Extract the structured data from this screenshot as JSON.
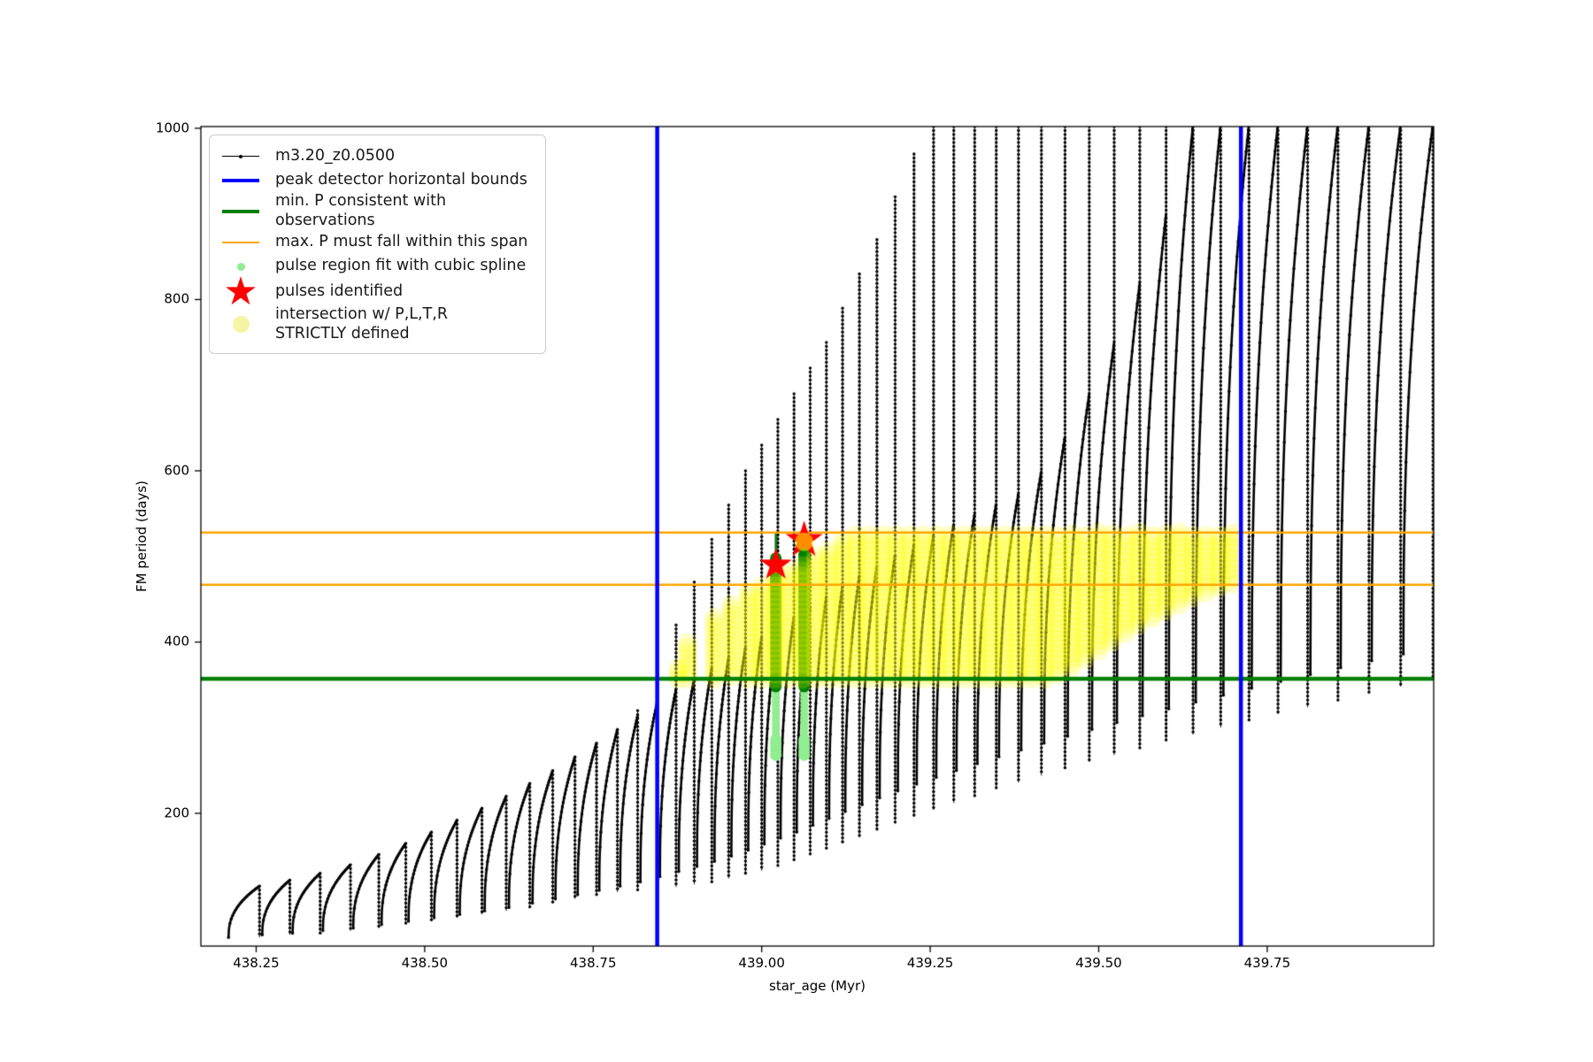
{
  "figure": {
    "background": "#ffffff",
    "xlabel": "star_age (Myr)",
    "ylabel": "FM period (days)"
  },
  "legend": {
    "items": [
      {
        "glyph": "black-line-dot-marker",
        "color": "#000000",
        "label": "m3.20_z0.0500"
      },
      {
        "glyph": "thick-blue-line",
        "color": "#0000ff",
        "label": "peak detector horizontal bounds"
      },
      {
        "glyph": "thick-green-line",
        "color": "#008000",
        "label": "min. P consistent with observations"
      },
      {
        "glyph": "thin-orange-line",
        "color": "#ffa500",
        "label": "max. P must fall within this span"
      },
      {
        "glyph": "small-lightgreen-dot",
        "color": "#90ee90",
        "label": "pulse region fit with cubic spline"
      },
      {
        "glyph": "red-star",
        "color": "#ff0000",
        "label": "pulses identified"
      },
      {
        "glyph": "large-paleyellow-dot",
        "color": "#f5f5a6",
        "label": "intersection w/ P,L,T,R\nSTRICTLY defined"
      }
    ]
  },
  "chart_data": {
    "type": "line",
    "title": "",
    "xlabel": "star_age (Myr)",
    "ylabel": "FM period (days)",
    "xlim": [
      438.168,
      439.997
    ],
    "ylim": [
      45,
      1002
    ],
    "grid": false,
    "legend_position": "upper left",
    "xticks": [
      {
        "v": 438.25,
        "label": "438.25"
      },
      {
        "v": 438.5,
        "label": "438.50"
      },
      {
        "v": 438.75,
        "label": "438.75"
      },
      {
        "v": 439.0,
        "label": "439.00"
      },
      {
        "v": 439.25,
        "label": "439.25"
      },
      {
        "v": 439.5,
        "label": "439.50"
      },
      {
        "v": 439.75,
        "label": "439.75"
      }
    ],
    "yticks": [
      {
        "v": 200,
        "label": "200"
      },
      {
        "v": 400,
        "label": "400"
      },
      {
        "v": 600,
        "label": "600"
      },
      {
        "v": 800,
        "label": "800"
      },
      {
        "v": 1000,
        "label": "1000"
      }
    ],
    "series_name": "m3.20_z0.0500",
    "series_color": "#000000",
    "peak_detector_bounds_x": [
      438.845,
      439.711
    ],
    "min_P_line_y": 357,
    "max_P_span_y": [
      467,
      528
    ],
    "line_colors": {
      "bounds": "#0000ff",
      "min_P": "#008000",
      "max_P": "#ffa500"
    },
    "pulses_identified": [
      {
        "x": 439.021,
        "y": 490
      },
      {
        "x": 439.063,
        "y": 519
      }
    ],
    "pulse_region_bars": [
      {
        "x": 439.021,
        "from": 348,
        "to": 498,
        "thin_tip_to": 527
      },
      {
        "x": 439.063,
        "from": 348,
        "to": 503
      }
    ],
    "spline_fit_columns": [
      {
        "x": 439.021,
        "from": 268,
        "to": 345
      },
      {
        "x": 439.063,
        "from": 268,
        "to": 345
      }
    ],
    "spline_fit_tips": [
      {
        "x": 439.063,
        "from": 503,
        "to": 513
      }
    ],
    "intersection_columns": [
      [
        438.876,
        357,
        372
      ],
      [
        438.89,
        357,
        400
      ],
      [
        438.93,
        357,
        432
      ],
      [
        438.955,
        360,
        445
      ],
      [
        438.98,
        357,
        462
      ],
      [
        439.0,
        357,
        470
      ],
      [
        439.02,
        357,
        478
      ],
      [
        439.04,
        357,
        486
      ],
      [
        439.06,
        357,
        494
      ],
      [
        439.08,
        357,
        502
      ],
      [
        439.1,
        357,
        510
      ],
      [
        439.12,
        357,
        519
      ],
      [
        439.14,
        357,
        528
      ],
      [
        439.16,
        357,
        528
      ],
      [
        439.18,
        357,
        528
      ],
      [
        439.2,
        357,
        528
      ],
      [
        439.22,
        357,
        528
      ],
      [
        439.24,
        357,
        528
      ],
      [
        439.26,
        357,
        528
      ],
      [
        439.28,
        357,
        528
      ],
      [
        439.3,
        357,
        528
      ],
      [
        439.32,
        357,
        528
      ],
      [
        439.34,
        357,
        528
      ],
      [
        439.36,
        357,
        528
      ],
      [
        439.38,
        357,
        528
      ],
      [
        439.4,
        357,
        528
      ],
      [
        439.42,
        357,
        528
      ],
      [
        439.44,
        362,
        528
      ],
      [
        439.46,
        370,
        528
      ],
      [
        439.48,
        380,
        528
      ],
      [
        439.5,
        390,
        528
      ],
      [
        439.52,
        400,
        528
      ],
      [
        439.54,
        410,
        528
      ],
      [
        439.56,
        420,
        528
      ],
      [
        439.58,
        428,
        528
      ],
      [
        439.6,
        436,
        528
      ],
      [
        439.62,
        444,
        528
      ],
      [
        439.64,
        452,
        528
      ],
      [
        439.66,
        458,
        528
      ],
      [
        439.68,
        464,
        528
      ],
      [
        439.7,
        468,
        528
      ]
    ],
    "pulse_cycles_fields": [
      "x_pulse",
      "min_start",
      "arc_peak",
      "spike_top",
      "spike_bottom"
    ],
    "pulse_cycles": [
      [
        438.255,
        55,
        115,
        115,
        55
      ],
      [
        438.3,
        58,
        122,
        122,
        58
      ],
      [
        438.345,
        60,
        130,
        130,
        60
      ],
      [
        438.39,
        63,
        140,
        140,
        63
      ],
      [
        438.432,
        66,
        152,
        152,
        66
      ],
      [
        438.472,
        70,
        165,
        165,
        70
      ],
      [
        438.51,
        74,
        178,
        178,
        74
      ],
      [
        438.548,
        78,
        192,
        192,
        78
      ],
      [
        438.585,
        82,
        206,
        206,
        82
      ],
      [
        438.621,
        86,
        220,
        220,
        86
      ],
      [
        438.656,
        90,
        235,
        235,
        90
      ],
      [
        438.69,
        95,
        250,
        250,
        95
      ],
      [
        438.723,
        100,
        266,
        266,
        100
      ],
      [
        438.755,
        105,
        282,
        282,
        105
      ],
      [
        438.786,
        110,
        298,
        298,
        108
      ],
      [
        438.816,
        115,
        314,
        320,
        110
      ],
      [
        438.845,
        120,
        330,
        345,
        112
      ],
      [
        438.873,
        126,
        345,
        420,
        114
      ],
      [
        438.9,
        132,
        358,
        470,
        117
      ],
      [
        438.926,
        138,
        370,
        520,
        120
      ],
      [
        438.951,
        144,
        382,
        560,
        124
      ],
      [
        438.976,
        150,
        394,
        600,
        128
      ],
      [
        439.0,
        157,
        406,
        630,
        133
      ],
      [
        439.024,
        164,
        418,
        660,
        139
      ],
      [
        439.048,
        171,
        430,
        690,
        145
      ],
      [
        439.072,
        178,
        442,
        720,
        151
      ],
      [
        439.096,
        186,
        454,
        750,
        158
      ],
      [
        439.12,
        194,
        466,
        790,
        165
      ],
      [
        439.145,
        202,
        478,
        830,
        172
      ],
      [
        439.171,
        210,
        490,
        870,
        180
      ],
      [
        439.198,
        218,
        502,
        920,
        188
      ],
      [
        439.226,
        226,
        514,
        970,
        196
      ],
      [
        439.255,
        234,
        526,
        1005,
        204
      ],
      [
        439.285,
        242,
        538,
        1005,
        212
      ],
      [
        439.316,
        250,
        550,
        1005,
        220
      ],
      [
        439.348,
        258,
        562,
        1005,
        228
      ],
      [
        439.381,
        266,
        574,
        1005,
        236
      ],
      [
        439.415,
        274,
        600,
        1005,
        244
      ],
      [
        439.45,
        282,
        640,
        1005,
        252
      ],
      [
        439.486,
        290,
        690,
        1005,
        260
      ],
      [
        439.523,
        298,
        750,
        1005,
        268
      ],
      [
        439.561,
        306,
        820,
        1005,
        276
      ],
      [
        439.6,
        314,
        900,
        1005,
        284
      ],
      [
        439.64,
        322,
        1005,
        1005,
        292
      ],
      [
        439.681,
        330,
        1005,
        1005,
        300
      ],
      [
        439.723,
        338,
        1005,
        1005,
        308
      ],
      [
        439.766,
        346,
        1005,
        1005,
        316
      ],
      [
        439.81,
        354,
        1005,
        1005,
        324
      ],
      [
        439.855,
        362,
        1005,
        1005,
        332
      ],
      [
        439.901,
        370,
        1005,
        1005,
        340
      ],
      [
        439.948,
        378,
        1005,
        1005,
        348
      ],
      [
        439.996,
        386,
        1005,
        1005,
        356
      ]
    ],
    "colors": {
      "series": "#000000",
      "bounds_blue": "#0000ff",
      "min_P_green": "#008000",
      "max_P_orange": "#ffa500",
      "spline_lightgreen": "#90ee90",
      "pulses_red": "#ff0000",
      "intersection_yellow": "#ffff00"
    }
  }
}
